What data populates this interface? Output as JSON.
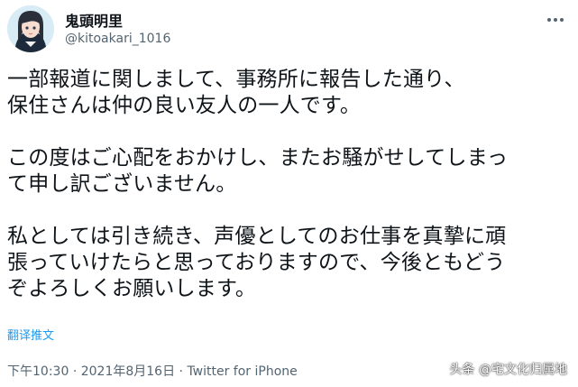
{
  "author": {
    "display_name": "鬼頭明里",
    "handle": "@kitoakari_1016"
  },
  "tweet": {
    "paragraphs": [
      [
        "一部報道に関しまして、事務所に報告した通り、",
        "保住さんは仲の良い友人の一人です。"
      ],
      [
        "この度はご心配をおかけし、またお騒がせしてしまっ",
        "て申し訳ございません。"
      ],
      [
        "私としては引き続き、声優としてのお仕事を真摯に頑",
        "張っていけたらと思っておりますので、今後ともどう",
        "ぞよろしくお願いします。"
      ]
    ],
    "translate_label": "翻译推文"
  },
  "meta": {
    "time": "下午10:30",
    "separator": "·",
    "date": "2021年8月16日",
    "source": "Twitter for iPhone"
  },
  "watermark": "头条 @宅文化归属地",
  "colors": {
    "text_primary": "#0f1419",
    "text_secondary": "#536471",
    "link": "#1d9bf0",
    "background": "#ffffff"
  },
  "icons": {
    "more": "more-horizontal-icon"
  }
}
